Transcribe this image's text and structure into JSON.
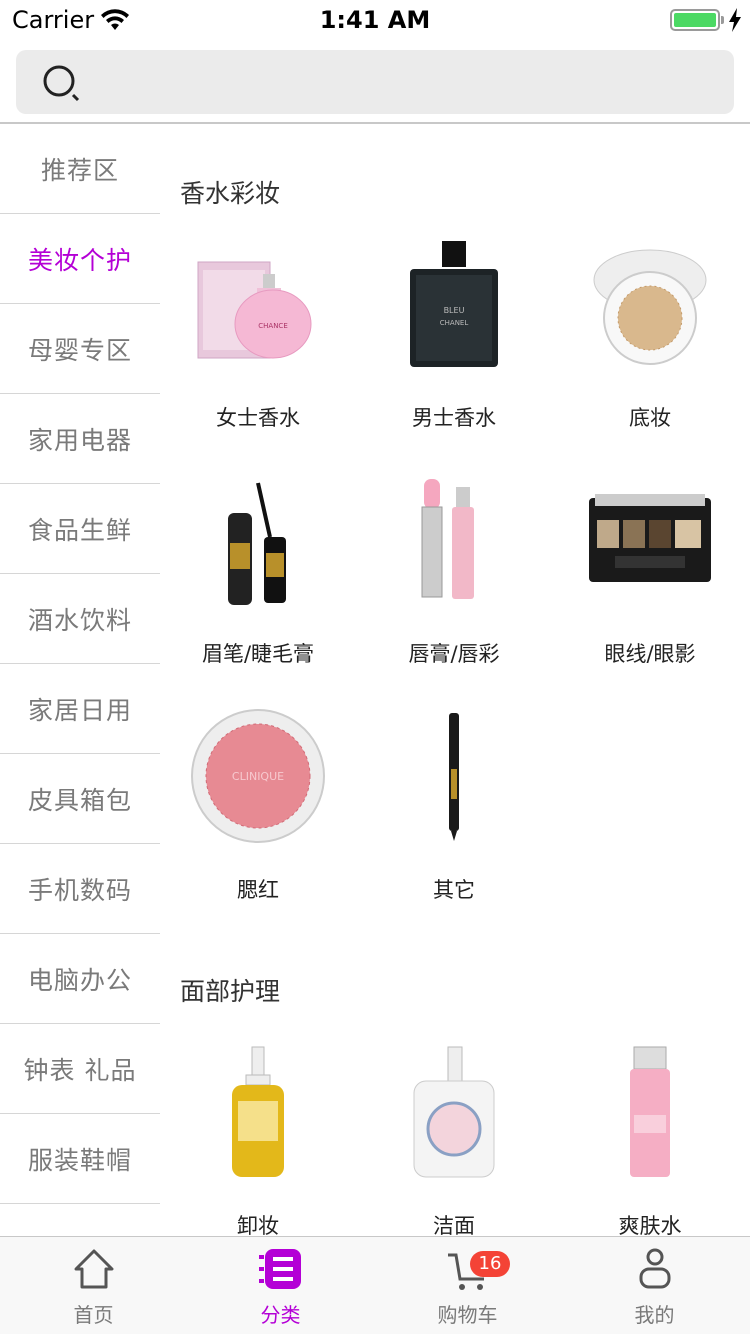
{
  "status_bar": {
    "carrier": "Carrier",
    "time": "1:41 AM"
  },
  "search": {
    "placeholder": ""
  },
  "sidebar": {
    "items": [
      {
        "label": "推荐区",
        "active": false
      },
      {
        "label": "美妆个护",
        "active": true
      },
      {
        "label": "母婴专区",
        "active": false
      },
      {
        "label": "家用电器",
        "active": false
      },
      {
        "label": "食品生鲜",
        "active": false
      },
      {
        "label": "酒水饮料",
        "active": false
      },
      {
        "label": "家居日用",
        "active": false
      },
      {
        "label": "皮具箱包",
        "active": false
      },
      {
        "label": "手机数码",
        "active": false
      },
      {
        "label": "电脑办公",
        "active": false
      },
      {
        "label": "钟表 礼品",
        "active": false
      },
      {
        "label": "服装鞋帽",
        "active": false
      }
    ]
  },
  "sections": [
    {
      "title": "香水彩妆",
      "products": [
        {
          "label": "女士香水",
          "icon": "perfume-pink-icon"
        },
        {
          "label": "男士香水",
          "icon": "perfume-black-icon"
        },
        {
          "label": "底妆",
          "icon": "cushion-compact-icon"
        },
        {
          "label": "眉笔/睫毛膏",
          "icon": "mascara-icon"
        },
        {
          "label": "唇膏/唇彩",
          "icon": "lipstick-icon"
        },
        {
          "label": "眼线/眼影",
          "icon": "eyeshadow-palette-icon"
        },
        {
          "label": "腮红",
          "icon": "blush-compact-icon"
        },
        {
          "label": "其它",
          "icon": "eyeliner-pen-icon"
        }
      ]
    },
    {
      "title": "面部护理",
      "products": [
        {
          "label": "卸妆",
          "icon": "cleansing-oil-icon"
        },
        {
          "label": "洁面",
          "icon": "face-wash-bottle-icon"
        },
        {
          "label": "爽肤水",
          "icon": "toner-bottle-icon"
        }
      ]
    }
  ],
  "tabbar": {
    "tabs": [
      {
        "label": "首页",
        "icon": "home-icon",
        "active": false
      },
      {
        "label": "分类",
        "icon": "category-icon",
        "active": true
      },
      {
        "label": "购物车",
        "icon": "cart-icon",
        "active": false,
        "badge": "16"
      },
      {
        "label": "我的",
        "icon": "profile-icon",
        "active": false
      }
    ]
  },
  "colors": {
    "accent": "#b400d6",
    "badge": "#f44336",
    "battery": "#4cd964"
  }
}
